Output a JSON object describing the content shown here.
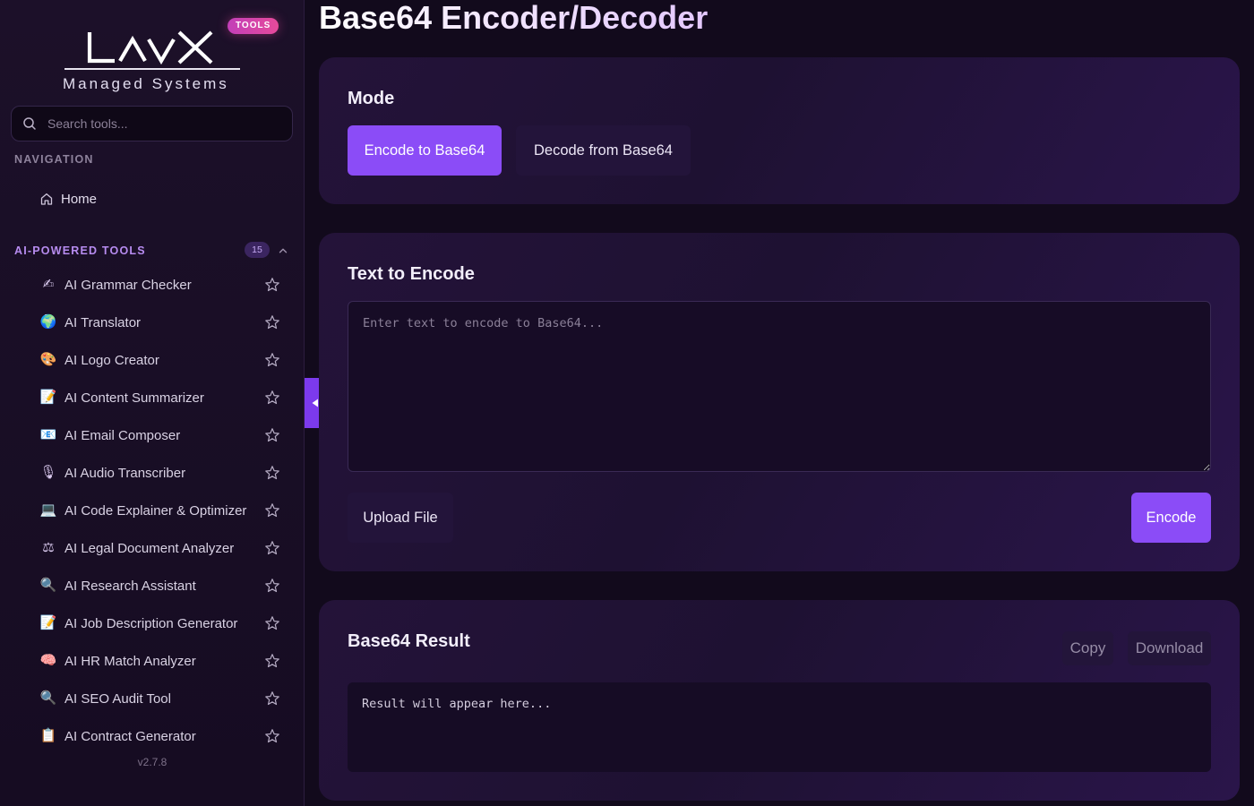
{
  "sidebar": {
    "logo": {
      "mark": "LAVX",
      "subtitle": "Managed Systems",
      "badge": "TOOLS"
    },
    "search": {
      "placeholder": "Search tools..."
    },
    "navigation_label": "NAVIGATION",
    "home_label": "Home",
    "ai_tools": {
      "label": "AI-POWERED TOOLS",
      "count": "15",
      "items": [
        {
          "emoji": "✍",
          "label": "AI Grammar Checker"
        },
        {
          "emoji": "🌍",
          "label": "AI Translator"
        },
        {
          "emoji": "🎨",
          "label": "AI Logo Creator"
        },
        {
          "emoji": "📝",
          "label": "AI Content Summarizer"
        },
        {
          "emoji": "📧",
          "label": "AI Email Composer"
        },
        {
          "emoji": "🎙",
          "label": "AI Audio Transcriber"
        },
        {
          "emoji": "💻",
          "label": "AI Code Explainer & Optimizer"
        },
        {
          "emoji": "⚖",
          "label": "AI Legal Document Analyzer"
        },
        {
          "emoji": "🔍",
          "label": "AI Research Assistant"
        },
        {
          "emoji": "📝",
          "label": "AI Job Description Generator"
        },
        {
          "emoji": "🧠",
          "label": "AI HR Match Analyzer"
        },
        {
          "emoji": "🔍",
          "label": "AI SEO Audit Tool"
        },
        {
          "emoji": "📋",
          "label": "AI Contract Generator"
        }
      ]
    },
    "version": "v2.7.8"
  },
  "main": {
    "title": "Base64 Encoder/Decoder",
    "mode": {
      "heading": "Mode",
      "encode_label": "Encode to Base64",
      "decode_label": "Decode from Base64",
      "active": "encode"
    },
    "input": {
      "heading": "Text to Encode",
      "placeholder": "Enter text to encode to Base64...",
      "upload_label": "Upload File",
      "encode_label": "Encode"
    },
    "result": {
      "heading": "Base64 Result",
      "copy_label": "Copy",
      "download_label": "Download",
      "placeholder": "Result will appear here..."
    }
  },
  "colors": {
    "accent": "#8b4cf7",
    "sidebar_bg": "#1c1029",
    "page_bg": "#120a1c",
    "badge_pink": "#e64a9b"
  }
}
